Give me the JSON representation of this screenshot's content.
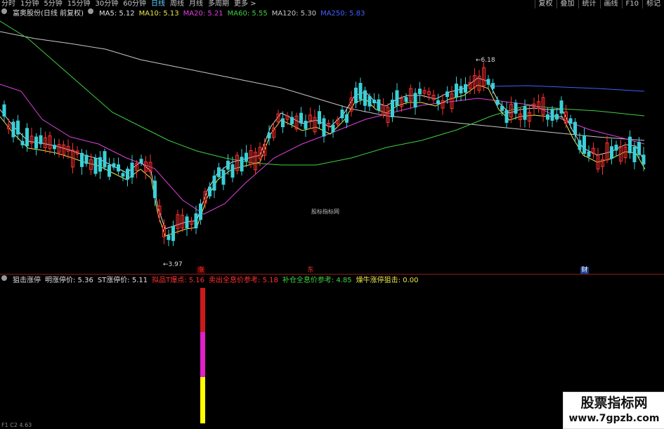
{
  "toolbar": {
    "tabs": [
      "分时",
      "1分钟",
      "5分钟",
      "15分钟",
      "30分钟",
      "60分钟",
      "日线",
      "周线",
      "月线",
      "多周期",
      "更多 >"
    ],
    "active_tab": "日线",
    "buttons": [
      "复权",
      "叠加",
      "统计",
      "画线",
      "F10",
      "标记"
    ]
  },
  "ma_legend": {
    "title": "富奥股份(日线 前复权)",
    "items": [
      {
        "label": "MA5: 5.12",
        "color": "#e0e0e0"
      },
      {
        "label": "MA10: 5.13",
        "color": "#e8e84a"
      },
      {
        "label": "MA20: 5.21",
        "color": "#e040e0"
      },
      {
        "label": "MA60: 5.55",
        "color": "#40d040"
      },
      {
        "label": "MA120: 5.30",
        "color": "#c8c8c8"
      },
      {
        "label": "MA250: 5.83",
        "color": "#4060ff"
      }
    ]
  },
  "price_labels": {
    "low": "←3.97",
    "high": "←6.18"
  },
  "center_watermark": "股标指标网",
  "markers": [
    {
      "text": "涨",
      "color": "#ff3030",
      "bg": "#400000"
    },
    {
      "text": "东",
      "color": "#ff3030",
      "bg": "#000000"
    },
    {
      "text": "财",
      "color": "#ffffff",
      "bg": "#1a3a8a"
    }
  ],
  "indicator_legend": {
    "name": "狙击涨停",
    "items": [
      {
        "label": "明涨停价: 5.36",
        "color": "#e0e0e0"
      },
      {
        "label": "ST涨停价: 5.11",
        "color": "#e0e0e0"
      },
      {
        "label": "拟品T爆点: 5.16",
        "color": "#ff3030"
      },
      {
        "label": "卖出全息价参考: 5.18",
        "color": "#ff3030"
      },
      {
        "label": "补仓全息价参考: 4.85",
        "color": "#40d040"
      },
      {
        "label": "燥牛涨停狙击: 0.00",
        "color": "#e8e84a"
      }
    ]
  },
  "signal_bar": {
    "segments": [
      "#cc1a1a",
      "#e020c8",
      "#ffff00"
    ]
  },
  "watermark": {
    "line1": "股票指标网",
    "line2": "www.7gpzb.com"
  },
  "bottom_text": "F1 C2 4.63"
}
